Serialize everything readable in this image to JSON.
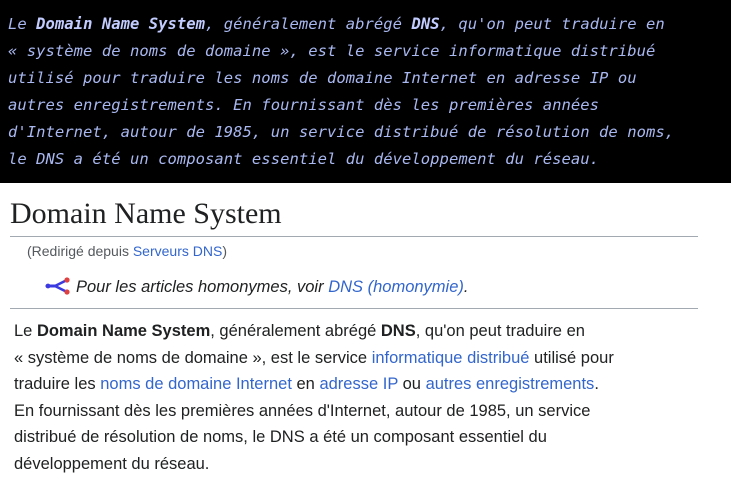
{
  "summary": {
    "l1_a": "Le ",
    "l1_b": "Domain Name System",
    "l1_c": ", généralement abrégé ",
    "l1_d": "DNS",
    "l1_e": ", qu'on peut traduire en",
    "l2": "« système de noms de domaine », est le service informatique distribué",
    "l3": "utilisé pour traduire les noms de domaine Internet en adresse IP ou",
    "l4": "autres enregistrements. En fournissant dès les premières années",
    "l5": "d'Internet, autour de 1985, un service distribué de résolution de noms,",
    "l6": "le DNS a été un composant essentiel du développement du réseau."
  },
  "article": {
    "title": "Domain Name System",
    "redirect_prefix": "(Redirigé depuis ",
    "redirect_link": "Serveurs DNS",
    "redirect_suffix": ")",
    "hatnote_text": "Pour les articles homonymes, voir ",
    "hatnote_link": "DNS (homonymie)",
    "hatnote_end": ".",
    "p": {
      "l1_a": "Le ",
      "l1_b": "Domain Name System",
      "l1_c": ", généralement abrégé ",
      "l1_d": "DNS",
      "l1_e": ", qu'on peut traduire en",
      "l2_a": "« système de noms de domaine », est le service ",
      "l2_link": "informatique distribué",
      "l2_b": " utilisé pour",
      "l3_a": "traduire les ",
      "l3_link1": "noms de domaine Internet",
      "l3_b": " en ",
      "l3_link2": "adresse IP",
      "l3_c": " ou ",
      "l3_link3": "autres enregistrements",
      "l3_d": ".",
      "l4": "En fournissant dès les premières années d'Internet, autour de 1985, un service",
      "l5": "distribué de résolution de noms, le DNS a été un composant essentiel du",
      "l6": "développement du réseau."
    }
  },
  "colors": {
    "summary_bg": "#000000",
    "summary_text": "#a9b8f0",
    "link": "#3366cc",
    "text": "#202122"
  },
  "icons": {
    "hatnote": "disambiguation-icon"
  }
}
